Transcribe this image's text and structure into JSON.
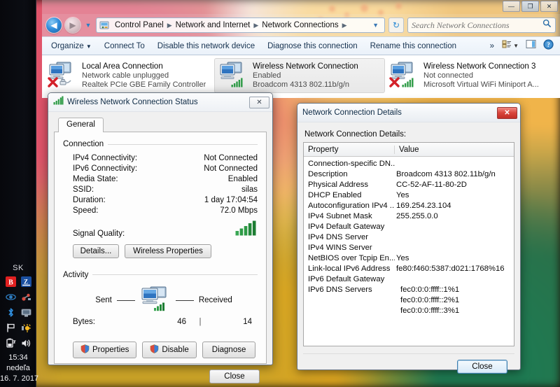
{
  "window": {
    "buttons": {
      "minimize": "—",
      "maximize": "❐",
      "close": "✕"
    }
  },
  "nav": {
    "back_icon": "◀",
    "forward_icon": "▶",
    "history_icon": "▼",
    "breadcrumb_icon": "control-panel-icon",
    "breadcrumb": [
      "Control Panel",
      "Network and Internet",
      "Network Connections"
    ],
    "separator": "▶",
    "dropdown": "▼",
    "refresh_icon": "↻"
  },
  "search": {
    "placeholder": "Search Network Connections",
    "value": "",
    "icon": "search-icon"
  },
  "toolbar": {
    "organize": "Organize",
    "organize_caret": "▼",
    "connect_to": "Connect To",
    "disable_device": "Disable this network device",
    "diagnose": "Diagnose this connection",
    "rename": "Rename this connection",
    "overflow": "»",
    "view_caret": "▼",
    "help": "?"
  },
  "connections": [
    {
      "name": "Local Area Connection",
      "status": "Network cable unplugged",
      "device": "Realtek PCIe GBE Family Controller",
      "selected": false,
      "badge": "x",
      "sub_badge": "cable"
    },
    {
      "name": "Wireless Network Connection",
      "status": "Enabled",
      "device": "Broadcom 4313 802.11b/g/n",
      "selected": true,
      "badge": "none",
      "sub_badge": "signal"
    },
    {
      "name": "Wireless Network Connection 3",
      "status": "Not connected",
      "device": "Microsoft Virtual WiFi Miniport A...",
      "selected": false,
      "badge": "x",
      "sub_badge": "signal"
    }
  ],
  "status_dialog": {
    "title": "Wireless Network Connection Status",
    "title_icon": "signal-bars-icon",
    "close_glyph": "✕",
    "tab": "General",
    "connection_group": "Connection",
    "rows": [
      {
        "key": "IPv4 Connectivity:",
        "value": "Not Connected"
      },
      {
        "key": "IPv6 Connectivity:",
        "value": "Not Connected"
      },
      {
        "key": "Media State:",
        "value": "Enabled"
      },
      {
        "key": "SSID:",
        "value": "silas"
      },
      {
        "key": "Duration:",
        "value": "1 day 17:04:54"
      },
      {
        "key": "Speed:",
        "value": "72.0 Mbps"
      }
    ],
    "signal_quality_label": "Signal Quality:",
    "signal_bars": 5,
    "details_button": "Details...",
    "wireless_properties_button": "Wireless Properties",
    "activity_group": "Activity",
    "sent_label": "Sent",
    "received_label": "Received",
    "bytes_label": "Bytes:",
    "bytes_sent": "46",
    "bytes_received": "14",
    "properties_button": "Properties",
    "disable_button": "Disable",
    "diagnose_button": "Diagnose",
    "close_button": "Close"
  },
  "details_dialog": {
    "title": "Network Connection Details",
    "close_glyph": "✕",
    "label": "Network Connection Details:",
    "columns": [
      "Property",
      "Value"
    ],
    "rows": [
      {
        "property": "Connection-specific DN...",
        "value": ""
      },
      {
        "property": "Description",
        "value": "Broadcom 4313 802.11b/g/n"
      },
      {
        "property": "Physical Address",
        "value": "CC-52-AF-11-80-2D"
      },
      {
        "property": "DHCP Enabled",
        "value": "Yes"
      },
      {
        "property": "Autoconfiguration IPv4 ...",
        "value": "169.254.23.104"
      },
      {
        "property": "IPv4 Subnet Mask",
        "value": "255.255.0.0"
      },
      {
        "property": "IPv4 Default Gateway",
        "value": ""
      },
      {
        "property": "IPv4 DNS Server",
        "value": ""
      },
      {
        "property": "IPv4 WINS Server",
        "value": ""
      },
      {
        "property": "NetBIOS over Tcpip En...",
        "value": "Yes"
      },
      {
        "property": "Link-local IPv6 Address",
        "value": "fe80:f460:5387:d021:1768%16"
      },
      {
        "property": "IPv6 Default Gateway",
        "value": ""
      },
      {
        "property": "IPv6 DNS Servers",
        "value": "fec0:0:0:ffff::1%1"
      },
      {
        "property": "",
        "value": "fec0:0:0:ffff::2%1"
      },
      {
        "property": "",
        "value": "fec0:0:0:ffff::3%1"
      }
    ],
    "close_button": "Close"
  },
  "taskbar": {
    "language": "SK",
    "tray_icons": [
      "bitdefender-icon",
      "zoner-icon",
      "eye-icon",
      "network-activity-icon",
      "bluetooth-icon",
      "display-icon",
      "flag-icon",
      "brightness-icon",
      "battery-icon",
      "volume-icon"
    ],
    "clock_time": "15:34",
    "clock_day": "nedeľa",
    "clock_date": "16. 7. 2017"
  },
  "colors": {
    "accent_blue": "#2f8ddb",
    "close_red": "#d9453c",
    "signal_green": "#2e9b46",
    "taskbar_black": "#0b0d13"
  }
}
